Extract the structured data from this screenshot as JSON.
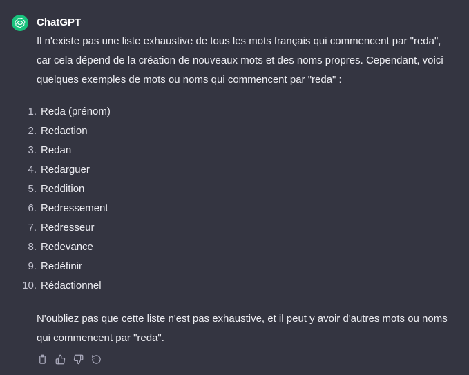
{
  "message": {
    "author": "ChatGPT",
    "avatar_color": "#19c37d",
    "intro": "Il n'existe pas une liste exhaustive de tous les mots français qui commencent par \"reda\", car cela dépend de la création de nouveaux mots et des noms propres. Cependant, voici quelques exemples de mots ou noms qui commencent par \"reda\" :",
    "items": [
      {
        "number": "1.",
        "text": "Reda (prénom)"
      },
      {
        "number": "2.",
        "text": "Redaction"
      },
      {
        "number": "3.",
        "text": "Redan"
      },
      {
        "number": "4.",
        "text": "Redarguer"
      },
      {
        "number": "5.",
        "text": "Reddition"
      },
      {
        "number": "6.",
        "text": "Redressement"
      },
      {
        "number": "7.",
        "text": "Redresseur"
      },
      {
        "number": "8.",
        "text": "Redevance"
      },
      {
        "number": "9.",
        "text": "Redéfinir"
      },
      {
        "number": "10.",
        "text": "Rédactionnel"
      }
    ],
    "closing": "N'oubliez pas que cette liste n'est pas exhaustive, et il peut y avoir d'autres mots ou noms qui commencent par \"reda\"."
  },
  "actions": [
    {
      "icon": "clipboard-icon"
    },
    {
      "icon": "thumbs-up-icon"
    },
    {
      "icon": "thumbs-down-icon"
    },
    {
      "icon": "regenerate-icon"
    }
  ],
  "colors": {
    "background": "#343541",
    "text": "#ececf1",
    "icon": "#acacbe"
  }
}
